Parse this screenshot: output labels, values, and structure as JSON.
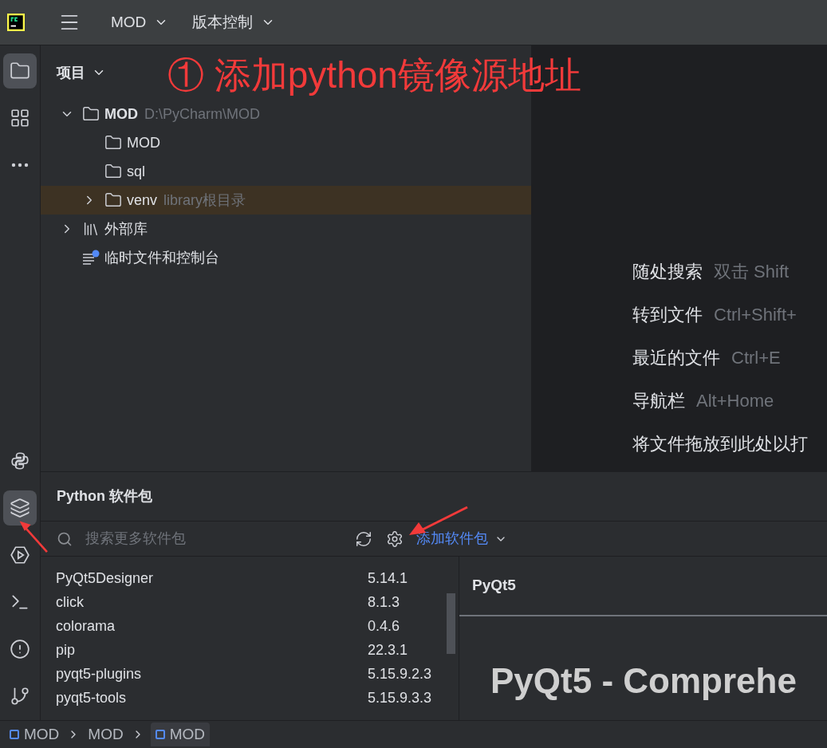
{
  "title_bar": {
    "menus": [
      {
        "label": "MOD"
      },
      {
        "label": "版本控制"
      }
    ]
  },
  "tool_strip": [
    {
      "kind": "folder",
      "selected": true
    },
    {
      "kind": "structure",
      "selected": false
    },
    {
      "kind": "more",
      "selected": false
    }
  ],
  "tool_strip_bottom": [
    {
      "kind": "python",
      "selected": false
    },
    {
      "kind": "layers",
      "selected": true
    },
    {
      "kind": "run",
      "selected": false
    },
    {
      "kind": "terminal",
      "selected": false
    },
    {
      "kind": "problems",
      "selected": false
    },
    {
      "kind": "git",
      "selected": false
    }
  ],
  "project": {
    "title": "项目",
    "tree": [
      {
        "kind": "folder",
        "label": "MOD",
        "hint": "D:\\PyCharm\\MOD",
        "expanded": true,
        "selected": false,
        "children": [
          {
            "kind": "folder",
            "label": "MOD",
            "selected": false
          },
          {
            "kind": "folder",
            "label": "sql",
            "selected": false
          },
          {
            "kind": "folder",
            "label": "venv",
            "hint": "library根目录",
            "expanded": false,
            "selected": true
          }
        ]
      },
      {
        "kind": "library",
        "label": "外部库",
        "expanded": false,
        "selected": false
      },
      {
        "kind": "scratch",
        "label": "临时文件和控制台",
        "selected": false
      }
    ]
  },
  "welcome": [
    {
      "action": "随处搜索",
      "shortcut": "双击 Shift"
    },
    {
      "action": "转到文件",
      "shortcut": "Ctrl+Shift+"
    },
    {
      "action": "最近的文件",
      "shortcut": "Ctrl+E"
    },
    {
      "action": "导航栏",
      "shortcut": "Alt+Home"
    },
    {
      "action": "将文件拖放到此处以打"
    }
  ],
  "packages": {
    "title": "Python 软件包",
    "search": {
      "placeholder": "搜索更多软件包"
    },
    "add_button": "添加软件包",
    "rows": [
      {
        "name": "PyQt5Designer",
        "version": "5.14.1"
      },
      {
        "name": "click",
        "version": "8.1.3"
      },
      {
        "name": "colorama",
        "version": "0.4.6"
      },
      {
        "name": "pip",
        "version": "22.3.1"
      },
      {
        "name": "pyqt5-plugins",
        "version": "5.15.9.2.3"
      },
      {
        "name": "pyqt5-tools",
        "version": "5.15.9.3.3"
      }
    ],
    "detail": {
      "name": "PyQt5",
      "heading": "PyQt5 - Comprehe"
    }
  },
  "breadcrumbs": [
    {
      "label": "MOD",
      "icon": true,
      "selected": false
    },
    {
      "label": "MOD",
      "icon": false,
      "selected": false
    },
    {
      "label": "MOD",
      "icon": true,
      "selected": true
    }
  ],
  "annotation": {
    "text": "① 添加python镜像源地址"
  }
}
